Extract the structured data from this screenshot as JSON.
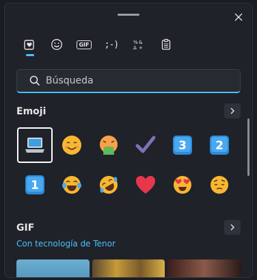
{
  "tabs": [
    {
      "name": "tab-favorites",
      "icon": "heart-clipboard-icon"
    },
    {
      "name": "tab-emoji",
      "icon": "smiley-icon"
    },
    {
      "name": "tab-gif",
      "label": "GIF"
    },
    {
      "name": "tab-kaomoji",
      "label": ";-)"
    },
    {
      "name": "tab-symbols",
      "icon": "symbols-icon"
    },
    {
      "name": "tab-clipboard",
      "icon": "clipboard-icon"
    }
  ],
  "search": {
    "placeholder": "Búsqueda",
    "value": ""
  },
  "emoji_section": {
    "title": "Emoji",
    "items": [
      "💻",
      "😊",
      "🤮",
      "✔",
      "3️⃣",
      "2️⃣",
      "1️⃣",
      "😂",
      "🤣",
      "❤️",
      "😍",
      "😔"
    ],
    "selected_index": 0
  },
  "gif_section": {
    "title": "GIF",
    "powered_by": "Con tecnología de Tenor"
  },
  "colors": {
    "accent": "#4cc2ff",
    "background": "#1f2229"
  }
}
